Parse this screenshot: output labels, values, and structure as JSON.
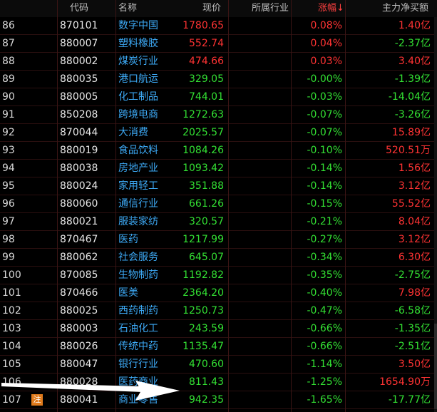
{
  "header": {
    "col_code": "代码",
    "col_name": "名称",
    "col_price": "现价",
    "col_industry": "所属行业",
    "col_change": "涨幅↓",
    "col_flow": "主力净买额"
  },
  "rows": [
    {
      "idx": "86",
      "code": "870101",
      "name": "数字中国",
      "price": "1780.65",
      "pct": "0.08%",
      "flow": "1.40亿",
      "pct_dir": "up",
      "flow_dir": "up"
    },
    {
      "idx": "87",
      "code": "880007",
      "name": "塑料橡胶",
      "price": "552.74",
      "pct": "0.04%",
      "flow": "-2.37亿",
      "pct_dir": "up",
      "flow_dir": "down"
    },
    {
      "idx": "88",
      "code": "880002",
      "name": "煤炭行业",
      "price": "474.66",
      "pct": "0.03%",
      "flow": "3.40亿",
      "pct_dir": "up",
      "flow_dir": "up"
    },
    {
      "idx": "89",
      "code": "880035",
      "name": "港口航运",
      "price": "329.05",
      "pct": "-0.00%",
      "flow": "-1.39亿",
      "pct_dir": "down",
      "flow_dir": "down"
    },
    {
      "idx": "90",
      "code": "880005",
      "name": "化工制品",
      "price": "744.01",
      "pct": "-0.03%",
      "flow": "-14.04亿",
      "pct_dir": "down",
      "flow_dir": "down"
    },
    {
      "idx": "91",
      "code": "850208",
      "name": "跨境电商",
      "price": "1272.63",
      "pct": "-0.07%",
      "flow": "-3.26亿",
      "pct_dir": "down",
      "flow_dir": "down"
    },
    {
      "idx": "92",
      "code": "870044",
      "name": "大消费",
      "price": "2025.57",
      "pct": "-0.07%",
      "flow": "15.89亿",
      "pct_dir": "down",
      "flow_dir": "up"
    },
    {
      "idx": "93",
      "code": "880019",
      "name": "食品饮料",
      "price": "1084.26",
      "pct": "-0.10%",
      "flow": "520.51万",
      "pct_dir": "down",
      "flow_dir": "up"
    },
    {
      "idx": "94",
      "code": "880038",
      "name": "房地产业",
      "price": "1093.42",
      "pct": "-0.14%",
      "flow": "1.56亿",
      "pct_dir": "down",
      "flow_dir": "up"
    },
    {
      "idx": "95",
      "code": "880024",
      "name": "家用轻工",
      "price": "351.88",
      "pct": "-0.14%",
      "flow": "3.12亿",
      "pct_dir": "down",
      "flow_dir": "up"
    },
    {
      "idx": "96",
      "code": "880060",
      "name": "通信行业",
      "price": "661.26",
      "pct": "-0.15%",
      "flow": "55.52亿",
      "pct_dir": "down",
      "flow_dir": "up"
    },
    {
      "idx": "97",
      "code": "880021",
      "name": "服装家纺",
      "price": "320.57",
      "pct": "-0.21%",
      "flow": "8.04亿",
      "pct_dir": "down",
      "flow_dir": "up"
    },
    {
      "idx": "98",
      "code": "870467",
      "name": "医药",
      "price": "1217.99",
      "pct": "-0.27%",
      "flow": "3.12亿",
      "pct_dir": "down",
      "flow_dir": "up"
    },
    {
      "idx": "99",
      "code": "880062",
      "name": "社会服务",
      "price": "645.07",
      "pct": "-0.34%",
      "flow": "6.30亿",
      "pct_dir": "down",
      "flow_dir": "up"
    },
    {
      "idx": "100",
      "code": "870085",
      "name": "生物制药",
      "price": "1192.82",
      "pct": "-0.35%",
      "flow": "-2.75亿",
      "pct_dir": "down",
      "flow_dir": "down"
    },
    {
      "idx": "101",
      "code": "870466",
      "name": "医美",
      "price": "2364.20",
      "pct": "-0.40%",
      "flow": "7.98亿",
      "pct_dir": "down",
      "flow_dir": "up"
    },
    {
      "idx": "102",
      "code": "880025",
      "name": "西药制药",
      "price": "1250.73",
      "pct": "-0.47%",
      "flow": "-6.58亿",
      "pct_dir": "down",
      "flow_dir": "down"
    },
    {
      "idx": "103",
      "code": "880003",
      "name": "石油化工",
      "price": "243.59",
      "pct": "-0.66%",
      "flow": "-1.35亿",
      "pct_dir": "down",
      "flow_dir": "down"
    },
    {
      "idx": "104",
      "code": "880026",
      "name": "传统中药",
      "price": "1135.47",
      "pct": "-0.66%",
      "flow": "-2.51亿",
      "pct_dir": "down",
      "flow_dir": "down"
    },
    {
      "idx": "105",
      "code": "880047",
      "name": "银行行业",
      "price": "470.60",
      "pct": "-1.14%",
      "flow": "3.50亿",
      "pct_dir": "down",
      "flow_dir": "up"
    },
    {
      "idx": "106",
      "code": "880028",
      "name": "医药商业",
      "price": "811.43",
      "pct": "-1.25%",
      "flow": "1654.90万",
      "pct_dir": "down",
      "flow_dir": "up"
    },
    {
      "idx": "107",
      "code": "880041",
      "name": "商业零售",
      "price": "942.35",
      "pct": "-1.65%",
      "flow": "-17.77亿",
      "pct_dir": "down",
      "flow_dir": "down",
      "note": "注"
    }
  ],
  "colors": {
    "up": "#ff3333",
    "down": "#33e033",
    "name": "#3da9f5",
    "note_badge": "#e07a1c",
    "arrow": "#ffffff"
  },
  "icons": {
    "sort_indicator": "sort-down-arrow-icon",
    "note": "note-badge-icon",
    "annotation": "annotation-arrow-icon"
  }
}
